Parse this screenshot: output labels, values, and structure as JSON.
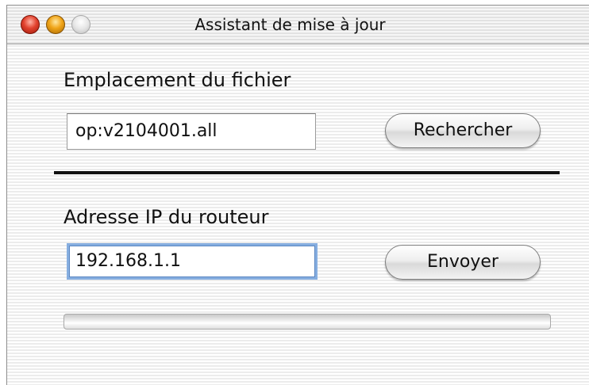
{
  "window": {
    "title": "Assistant de mise à  jour"
  },
  "file_section": {
    "label": "Emplacement du fichier",
    "value": "op:v2104001.all",
    "button_label": "Rechercher"
  },
  "router_section": {
    "label": "Adresse IP du routeur",
    "value": "192.168.1.1",
    "button_label": "Envoyer"
  },
  "progress": {
    "fraction": 0
  },
  "colors": {
    "focus_ring": "#86aee0",
    "close_button": "#e2422e",
    "minimize_button": "#f0a417",
    "zoom_button": "#e6e6e6"
  }
}
